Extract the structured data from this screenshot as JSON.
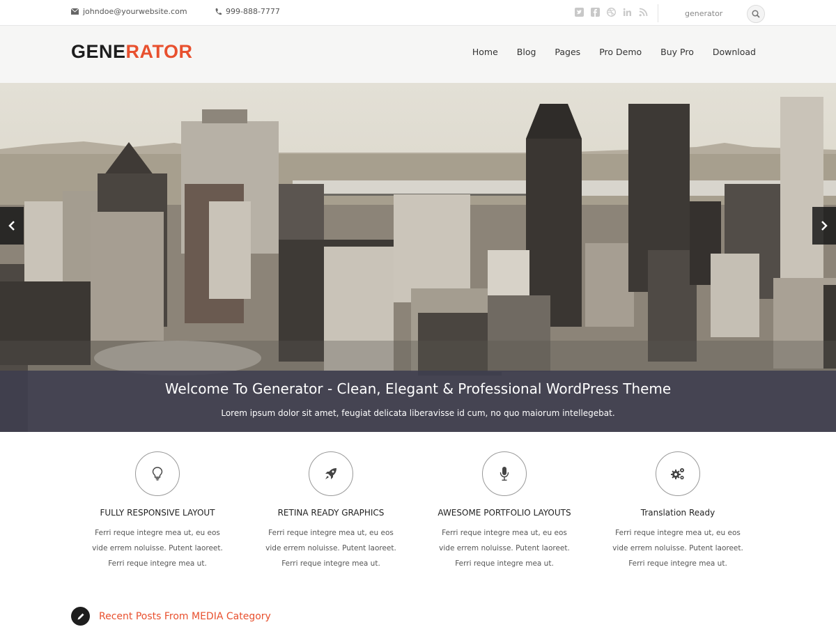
{
  "topbar": {
    "email": "johndoe@yourwebsite.com",
    "phone": "999-888-7777",
    "social_icons": [
      "twitter-icon",
      "facebook-icon",
      "dribbble-icon",
      "linkedin-icon",
      "rss-icon"
    ],
    "search_placeholder": "generator"
  },
  "header": {
    "logo_part1": "GENE",
    "logo_part2": "RATOR",
    "nav": [
      "Home",
      "Blog",
      "Pages",
      "Pro Demo",
      "Buy Pro",
      "Download"
    ]
  },
  "hero": {
    "title": "Welcome To Generator - Clean, Elegant & Professional WordPress Theme",
    "subtitle": "Lorem ipsum dolor sit amet, feugiat delicata liberavisse id cum, no quo maiorum intellegebat."
  },
  "features": [
    {
      "icon": "lightbulb-icon",
      "title": "FULLY RESPONSIVE LAYOUT",
      "desc": "Ferri reque integre mea ut, eu eos vide errem noluisse. Putent laoreet. Ferri reque integre mea ut."
    },
    {
      "icon": "rocket-icon",
      "title": "RETINA READY GRAPHICS",
      "desc": "Ferri reque integre mea ut, eu eos vide errem noluisse. Putent laoreet. Ferri reque integre mea ut."
    },
    {
      "icon": "microphone-icon",
      "title": "AWESOME PORTFOLIO LAYOUTS",
      "desc": "Ferri reque integre mea ut, eu eos vide errem noluisse. Putent laoreet. Ferri reque integre mea ut."
    },
    {
      "icon": "gears-icon",
      "title": "Translation Ready",
      "desc": "Ferri reque integre mea ut, eu eos vide errem noluisse. Putent laoreet. Ferri reque integre mea ut."
    }
  ],
  "recent": {
    "title": "Recent Posts From MEDIA Category"
  },
  "colors": {
    "accent": "#e8502e",
    "dark": "#1d1d1d",
    "caption_bg": "#3e3e4e"
  }
}
